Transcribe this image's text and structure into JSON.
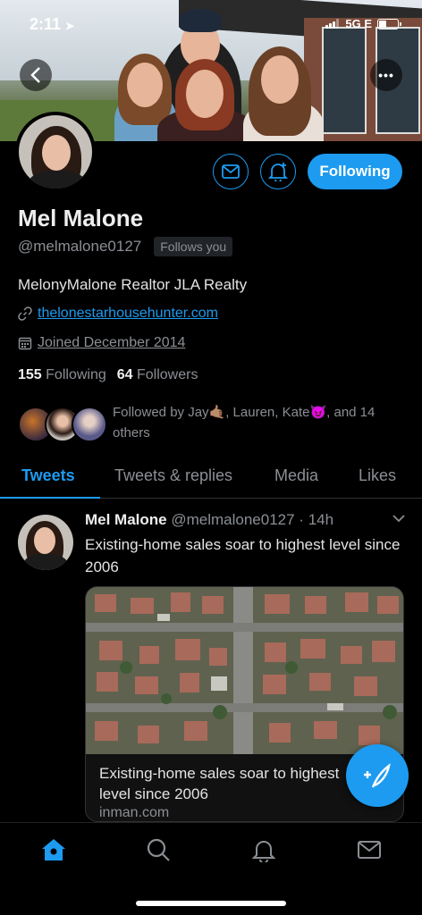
{
  "status_bar": {
    "time": "2:11",
    "network": "5G E"
  },
  "header": {
    "back_icon": "chevron-left-icon",
    "more_icon": "more-icon",
    "more_label": "•••"
  },
  "profile": {
    "name": "Mel Malone",
    "handle": "@melmalone0127",
    "follows_you": "Follows you",
    "bio": "MelonyMalone Realtor JLA Realty",
    "website": "thelonestarhousehunter.com",
    "joined": "Joined December 2014",
    "following_count": "155",
    "following_label": "Following",
    "followers_count": "64",
    "followers_label": "Followers",
    "followed_by": "Followed by Jay🤙🏽, Lauren, Kate😈, and 14 others"
  },
  "actions": {
    "follow_label": "Following",
    "accent": "#1d9bf0"
  },
  "tabs": [
    {
      "label": "Tweets",
      "active": true
    },
    {
      "label": "Tweets & replies",
      "active": false
    },
    {
      "label": "Media",
      "active": false
    },
    {
      "label": "Likes",
      "active": false
    }
  ],
  "tweet": {
    "author": "Mel Malone",
    "meta": "@melmalone0127 · 14h",
    "text": "Existing-home sales soar to highest level since 2006",
    "card_title": "Existing-home sales soar to highest level since 2006",
    "card_domain": "inman.com"
  },
  "bottom_nav": [
    "home-icon",
    "search-icon",
    "bell-icon",
    "mail-icon"
  ]
}
